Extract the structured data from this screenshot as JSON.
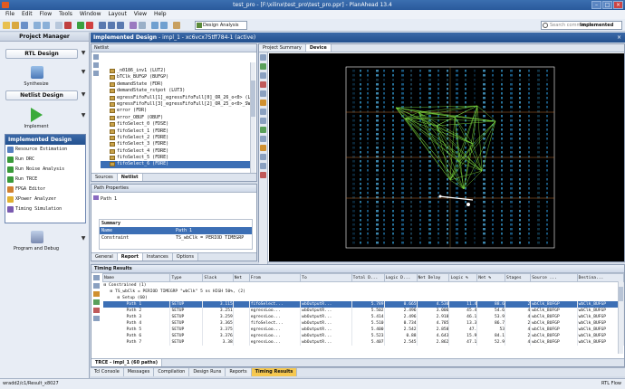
{
  "window": {
    "title": "test_pro - [F:\\xilinx\\test_pro\\test_pro.ppr] - PlanAhead 13.4"
  },
  "menu": [
    "File",
    "Edit",
    "Flow",
    "Tools",
    "Window",
    "Layout",
    "View",
    "Help"
  ],
  "toolbar": {
    "layout_value": "Design Analysis",
    "search_placeholder": "Search commands",
    "state": "Implemented"
  },
  "flow_navigator": {
    "title": "Project Manager",
    "rtl_design": "RTL Design",
    "synthesize": "Synthesize",
    "netlist_design": "Netlist Design",
    "implement": "Implement",
    "implemented_design": {
      "title": "Implemented Design",
      "items": [
        "Resource Estimation",
        "Run DRC",
        "Run Noise Analysis",
        "Run TRCE",
        "FPGA Editor",
        "XPower Analyzer",
        "Timing Simulation"
      ]
    },
    "program_and_debug": "Program and Debug"
  },
  "design_header": {
    "title": "Implemented Design",
    "detail": "impl_1 - xc6vcx75tff784-1 (active)"
  },
  "netlist": {
    "title": "Netlist",
    "rows": [
      "_n0186_inv1 (LUT2)",
      "bTClk_BUFGP (BUFGP)",
      "demandState (FDR)",
      "demandState_rstpot (LUT3)",
      "egressFifoFull[1]_egressFifoFull[0]_OR_26_o<0> (LUT2)",
      "egressFifoFull[3]_egressFifoFull[2]_OR_25_o<0>_SW0 (LUT2)",
      "error (FDR)",
      "error_OBUF (OBUF)",
      "fifoSelect_0 (FDSE)",
      "fifoSelect_1 (FDRE)",
      "fifoSelect_2 (FDRE)",
      "fifoSelect_3 (FDRE)",
      "fifoSelect_4 (FDRE)",
      "fifoSelect_5 (FDRE)",
      "fifoSelect_6 (FDRE)"
    ],
    "selected_index": 14,
    "tabs": [
      "Sources",
      "Netlist"
    ]
  },
  "path_properties": {
    "title": "Path Properties",
    "path_label": "Path 1",
    "section": "Summary",
    "name_label": "Name",
    "name_value": "Path 1",
    "constraint_label": "Constraint",
    "constraint_value": "TS_wbClk = PERIOD TIMEGRP",
    "tabs": [
      "General",
      "Report",
      "Instances",
      "Options"
    ]
  },
  "device": {
    "tabs": [
      "Project Summary",
      "Device"
    ]
  },
  "timing_results": {
    "title": "Timing Results",
    "columns": [
      "Name",
      "Type",
      "Slack",
      "Net",
      "From",
      "To",
      "Total D...",
      "Logic D...",
      "Net Delay",
      "Logic %",
      "Net %",
      "Stages",
      "Source ...",
      "Destina..."
    ],
    "group_constrained": "Constrained (1)",
    "group_ts": "TS_wbClk = PERIOD TIMEGRP \"wbClk\" 5 ns HIGH 50%, (2)",
    "group_setup": "Setup (60)",
    "rows": [
      [
        "Path 1",
        "SETUP",
        "3.115",
        "",
        "fifoSelect...",
        "wbOutputR...",
        "5.789",
        "0.665",
        "4.530",
        "11.4",
        "88.6",
        "2",
        "wbClk_BUFGP",
        "wbClk_BUFGP"
      ],
      [
        "Path 2",
        "SETUP",
        "3.251",
        "",
        "egressLoo...",
        "wbOutputR...",
        "5.502",
        "2.496",
        "3.006",
        "45.4",
        "54.6",
        "4",
        "wbClk_BUFGP",
        "wbClk_BUFGP"
      ],
      [
        "Path 3",
        "SETUP",
        "3.259",
        "",
        "egressLoo...",
        "wbOutputR...",
        "5.414",
        "2.496",
        "2.918",
        "46.1",
        "53.9",
        "4",
        "wbClk_BUFGP",
        "wbClk_BUFGP"
      ],
      [
        "Path 4",
        "SETUP",
        "3.365",
        "",
        "fifoSelect...",
        "wbOutputR...",
        "5.510",
        "0.734",
        "4.785",
        "13.3",
        "86.7",
        "2",
        "wbClk_BUFGP",
        "wbClk_BUFGP"
      ],
      [
        "Path 5",
        "SETUP",
        "3.375",
        "",
        "egressLoo...",
        "wbOutputR...",
        "5.400",
        "2.542",
        "2.858",
        "47.",
        "53",
        "4",
        "wbClk_BUFGP",
        "wbClk_BUFGP"
      ],
      [
        "Path 6",
        "SETUP",
        "3.376",
        "",
        "egressLoo...",
        "wbOutputR...",
        "5.523",
        "0.88",
        "4.643",
        "15.9",
        "84.1",
        "2",
        "wbClk_BUFGP",
        "wbClk_BUFGP"
      ],
      [
        "Path 7",
        "SETUP",
        "3.38",
        "",
        "egressLoo...",
        "wbOutputR...",
        "5.407",
        "2.545",
        "2.862",
        "47.1",
        "52.9",
        "4",
        "wbClk_BUFGP",
        "wbClk_BUFGP"
      ]
    ]
  },
  "bottom_tabs": [
    "TRCE - impl_1 (60 paths)"
  ],
  "console_tabs": [
    "Tcl Console",
    "Messages",
    "Compilation",
    "Design Runs",
    "Reports",
    "Timing Results"
  ],
  "status": {
    "left": "wradd2/c1/Result_x8027",
    "right": "RTL Flow"
  },
  "colors": {
    "accent": "#2a5a9c",
    "selection": "#3c6fb5",
    "active_tab": "#f6c850",
    "routing": "#7fe040"
  }
}
